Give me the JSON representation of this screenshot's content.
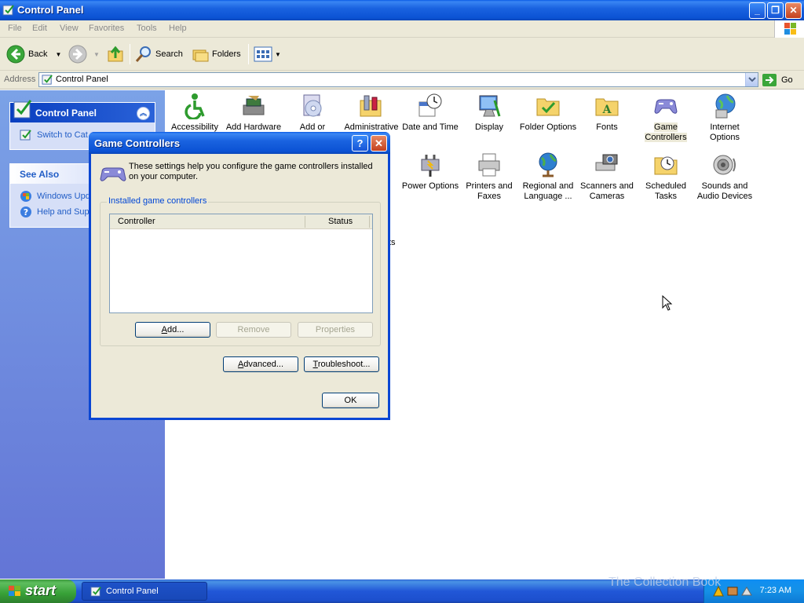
{
  "window": {
    "title": "Control Panel"
  },
  "menu": [
    "File",
    "Edit",
    "View",
    "Favorites",
    "Tools",
    "Help"
  ],
  "toolbar": {
    "back": "Back",
    "search": "Search",
    "folders": "Folders"
  },
  "address": {
    "label": "Address",
    "value": "Control Panel",
    "go": "Go"
  },
  "left_pane": {
    "cp_panel": {
      "title": "Control Panel",
      "link": "Switch to Cat"
    },
    "see_also": {
      "title": "See Also",
      "links": [
        "Windows Upd",
        "Help and Supp"
      ]
    }
  },
  "items": [
    {
      "label": "Accessibility",
      "icon": "accessibility-icon"
    },
    {
      "label": "Add Hardware",
      "icon": "add-hardware-icon"
    },
    {
      "label": "Add or",
      "icon": "add-remove-programs-icon"
    },
    {
      "label": "Administrative",
      "icon": "admin-tools-icon"
    },
    {
      "label": "Date and Time",
      "icon": "date-time-icon"
    },
    {
      "label": "Display",
      "icon": "display-icon"
    },
    {
      "label": "Folder Options",
      "icon": "folder-options-icon"
    },
    {
      "label": "Fonts",
      "icon": "fonts-icon"
    },
    {
      "label": "Game Controllers",
      "icon": "game-controllers-icon"
    },
    {
      "label": "Internet Options",
      "icon": "internet-options-icon"
    },
    {
      "label": "Power Options",
      "icon": "power-options-icon"
    },
    {
      "label": "Printers and Faxes",
      "icon": "printers-icon"
    },
    {
      "label": "Regional and Language ...",
      "icon": "regional-icon"
    },
    {
      "label": "Scanners and Cameras",
      "icon": "scanners-icon"
    },
    {
      "label": "Scheduled Tasks",
      "icon": "scheduled-tasks-icon"
    },
    {
      "label": "Sounds and Audio Devices",
      "icon": "sounds-icon"
    }
  ],
  "partial_text": "ts",
  "dialog": {
    "title": "Game Controllers",
    "intro": "These settings help you configure the game controllers installed on your computer.",
    "group_title": "Installed game controllers",
    "columns": [
      "Controller",
      "Status"
    ],
    "buttons": {
      "add": "Add...",
      "remove": "Remove",
      "properties": "Properties",
      "advanced": "Advanced...",
      "troubleshoot": "Troubleshoot...",
      "ok": "OK"
    }
  },
  "taskbar": {
    "start": "start",
    "task": "Control Panel",
    "clock": "7:23 AM",
    "watermark": "The Collection Book"
  }
}
